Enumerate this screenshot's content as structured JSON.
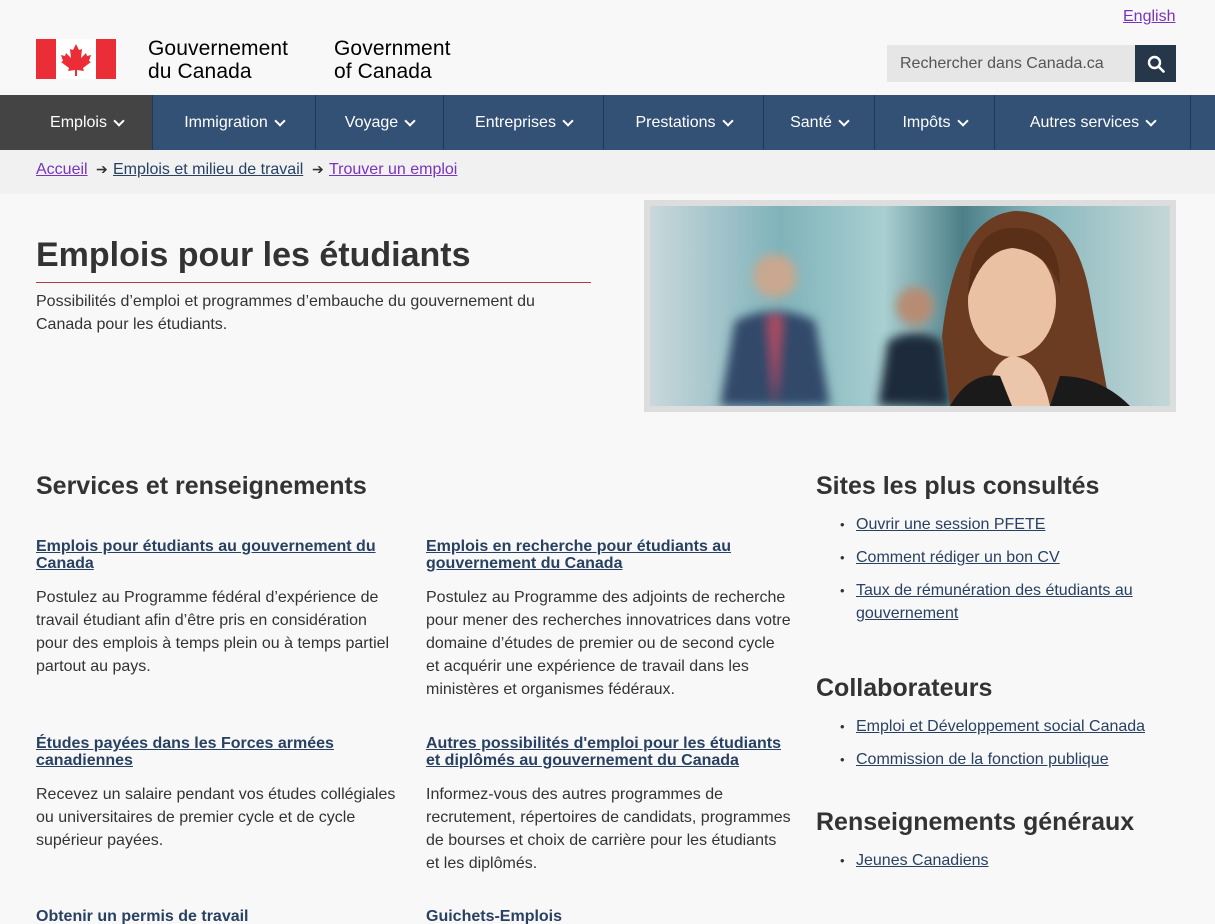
{
  "header": {
    "language_link": "English",
    "signature_fr_line1": "Gouvernement",
    "signature_fr_line2": "du Canada",
    "signature_en_line1": "Government",
    "signature_en_line2": "of Canada",
    "search_placeholder": "Rechercher dans Canada.ca",
    "flag_color": "#eb2d37"
  },
  "nav": {
    "items": [
      {
        "label": "Emplois"
      },
      {
        "label": "Immigration"
      },
      {
        "label": "Voyage"
      },
      {
        "label": "Entreprises"
      },
      {
        "label": "Prestations"
      },
      {
        "label": "Santé"
      },
      {
        "label": "Impôts"
      },
      {
        "label": "Autres services"
      }
    ]
  },
  "breadcrumb": {
    "items": [
      "Accueil",
      "Emplois et milieu de travail",
      "Trouver un emploi"
    ]
  },
  "page": {
    "title": "Emplois pour les étudiants",
    "intro": "Possibilités d’emploi et programmes d’embauche du gouvernement du Canada pour les étudiants."
  },
  "services": {
    "heading": "Services et renseignements",
    "items": [
      {
        "title": "Emplois pour étudiants au gouvernement du Canada",
        "desc": "Postulez au Programme fédéral d’expérience de travail étudiant afin d’être pris en considération pour des emplois à temps plein ou à temps partiel partout au pays."
      },
      {
        "title": "Emplois en recherche pour étudiants au gouvernement du Canada",
        "desc": "Postulez au Programme des adjoints de recherche pour mener des recherches innovatrices dans votre domaine d’études de premier ou de second cycle et acquérir une expérience de travail dans les ministères et organismes fédéraux."
      },
      {
        "title": "Études payées dans les Forces armées canadiennes",
        "desc": "Recevez un salaire pendant vos études collégiales ou universitaires de premier cycle et de cycle supérieur payées."
      },
      {
        "title": "Autres possibilités d'emploi pour les étudiants et diplômés au gouvernement du Canada",
        "desc": "Informez-vous des autres programmes de recrutement, répertoires de candidats, programmes de bourses et choix de carrière pour les étudiants et les diplômés."
      },
      {
        "title": "Obtenir un permis de travail",
        "desc": ""
      },
      {
        "title": "Guichets-Emplois",
        "desc": ""
      }
    ]
  },
  "sidebar": {
    "most_visited": {
      "heading": "Sites les plus consultés",
      "links": [
        "Ouvrir une session PFETE",
        "Comment rédiger un bon CV",
        "Taux de rémunération des étudiants au gouvernement"
      ]
    },
    "partners": {
      "heading": "Collaborateurs",
      "links": [
        "Emploi et Développement social Canada",
        "Commission de la fonction publique"
      ]
    },
    "general": {
      "heading": "Renseignements généraux",
      "links": [
        "Jeunes Canadiens"
      ]
    }
  }
}
